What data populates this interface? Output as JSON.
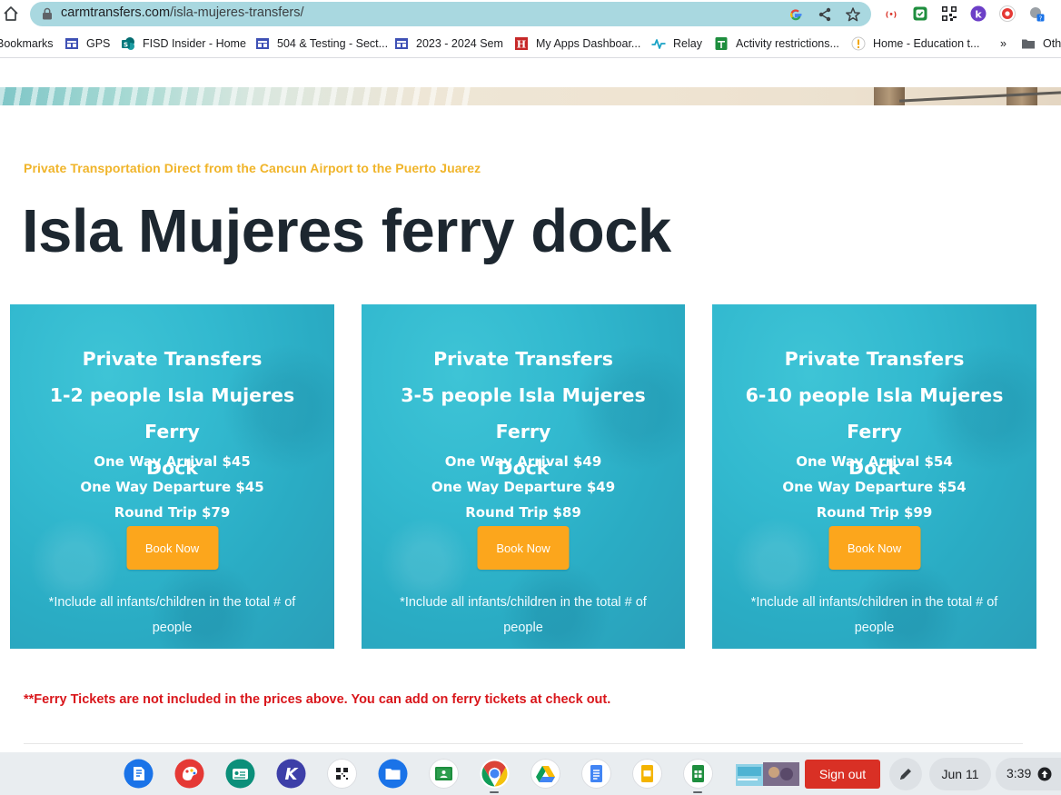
{
  "browser": {
    "url_host": "carmtransfers.com",
    "url_path": "/isla-mujeres-transfers/"
  },
  "bookmarks": [
    {
      "label": "Bookmarks",
      "icon": "none"
    },
    {
      "label": "GPS",
      "icon": "site-icon"
    },
    {
      "label": "FISD Insider - Home",
      "icon": "sharepoint-icon"
    },
    {
      "label": "504 & Testing - Sect...",
      "icon": "site-icon"
    },
    {
      "label": "2023 - 2024 Sem",
      "icon": "site-icon"
    },
    {
      "label": "My Apps Dashboar...",
      "icon": "h-icon"
    },
    {
      "label": "Relay",
      "icon": "relay-icon"
    },
    {
      "label": "Activity restrictions...",
      "icon": "sheets-icon"
    },
    {
      "label": "Home - Education t...",
      "icon": "warning-icon"
    },
    {
      "label": "»",
      "icon": "none"
    },
    {
      "label": "Othe",
      "icon": "folder-icon"
    }
  ],
  "page": {
    "eyebrow": "Private Transportation Direct from the Cancun Airport to the Puerto Juarez",
    "title": "Isla Mujeres ferry dock",
    "ferry_note": "**Ferry Tickets are not included in the prices above. You can add on ferry tickets at check out."
  },
  "cards": [
    {
      "title_line1": "Private Transfers",
      "title_line2": "1-2 people Isla Mujeres Ferry",
      "title_line3": "Dock",
      "arrival": "One Way Arrival $45",
      "departure": "One Way Departure $45",
      "round_trip": "Round Trip $79",
      "button": "Book Now",
      "note": "*Include all infants/children in the total # of people"
    },
    {
      "title_line1": "Private Transfers",
      "title_line2": "3-5 people Isla Mujeres Ferry",
      "title_line3": "Dock",
      "arrival": "One Way Arrival $49",
      "departure": "One Way Departure $49",
      "round_trip": "Round Trip $89",
      "button": "Book Now",
      "note": "*Include all infants/children in the total # of people"
    },
    {
      "title_line1": "Private Transfers",
      "title_line2": "6-10 people Isla Mujeres Ferry",
      "title_line3": "Dock",
      "arrival": "One Way Arrival $54",
      "departure": "One Way Departure $54",
      "round_trip": "Round Trip $99",
      "button": "Book Now",
      "note": "*Include all infants/children in the total # of people"
    }
  ],
  "shelf": {
    "apps": [
      "launcher-icon",
      "canvas-icon",
      "classroom-id-icon",
      "kami-icon",
      "qr-icon",
      "files-icon",
      "google-classroom-icon",
      "chrome-icon",
      "drive-icon",
      "docs-icon",
      "slides-icon",
      "sheets-icon",
      "window-preview"
    ],
    "signout_label": "Sign out",
    "date": "Jun 11",
    "time": "3:39"
  },
  "colors": {
    "accent_yellow": "#f0b429",
    "card_teal": "#32b9cf",
    "button_orange": "#fca61c",
    "note_red": "#d9161b",
    "title_dark": "#1d2730"
  }
}
